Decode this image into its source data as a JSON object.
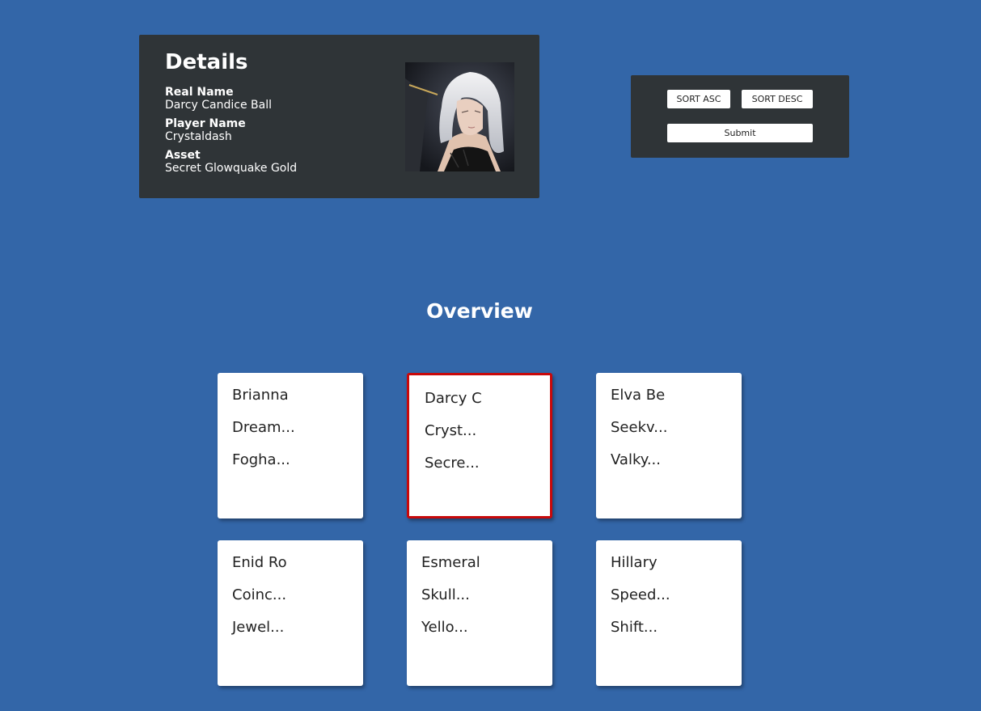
{
  "details": {
    "title": "Details",
    "real_name_label": "Real Name",
    "real_name": "Darcy Candice Ball",
    "player_name_label": "Player Name",
    "player_name": "Crystaldash",
    "asset_label": "Asset",
    "asset": "Secret Glowquake Gold"
  },
  "controls": {
    "sort_asc": "SORT ASC",
    "sort_desc": "SORT DESC",
    "submit": "Submit"
  },
  "overview": {
    "title": "Overview",
    "cards": [
      {
        "name": "Brianna",
        "player": "Dream...",
        "asset": "Fogha...",
        "selected": false
      },
      {
        "name": "Darcy C",
        "player": "Cryst...",
        "asset": "Secre...",
        "selected": true
      },
      {
        "name": "Elva Be",
        "player": "Seekv...",
        "asset": "Valky...",
        "selected": false
      },
      {
        "name": "Enid Ro",
        "player": "Coinc...",
        "asset": "Jewel...",
        "selected": false
      },
      {
        "name": "Esmeral",
        "player": "Skull...",
        "asset": "Yello...",
        "selected": false
      },
      {
        "name": "Hillary",
        "player": "Speed...",
        "asset": "Shift...",
        "selected": false
      }
    ]
  },
  "colors": {
    "background": "#3366a8",
    "panel": "#2f3437",
    "selected_border": "#c8090b"
  }
}
